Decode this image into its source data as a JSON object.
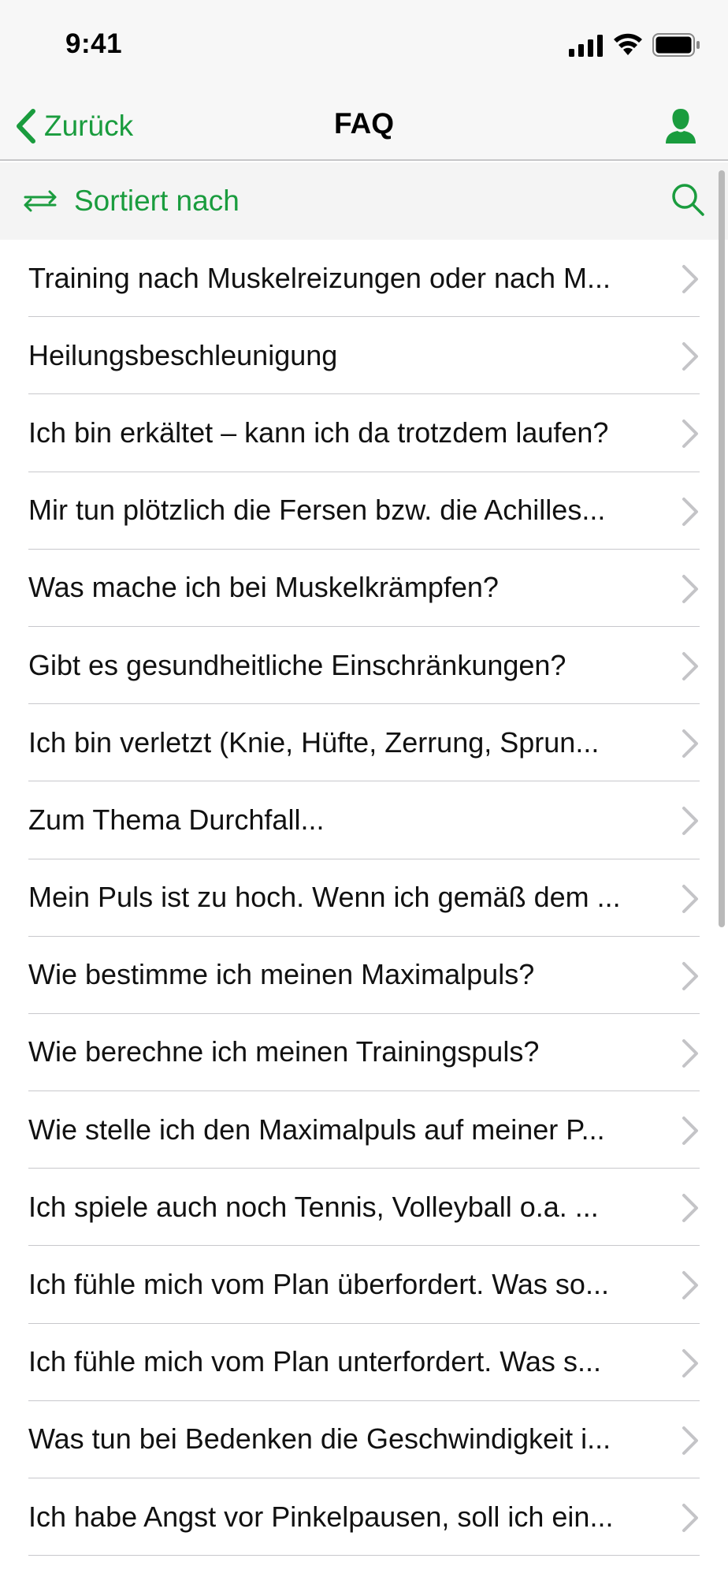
{
  "status_bar": {
    "time": "9:41"
  },
  "nav": {
    "back_label": "Zurück",
    "title": "FAQ"
  },
  "sort_bar": {
    "label": "Sortiert nach"
  },
  "accent_color": "#1a9c3e",
  "faq_items": [
    "Training nach Muskelreizungen oder nach M...",
    "Heilungsbeschleunigung",
    "Ich bin erkältet – kann ich da trotzdem laufen?",
    "Mir tun plötzlich die Fersen bzw. die Achilles...",
    "Was mache ich bei Muskelkrämpfen?",
    "Gibt es gesundheitliche Einschränkungen?",
    "Ich bin verletzt (Knie, Hüfte, Zerrung, Sprun...",
    "Zum Thema Durchfall...",
    "Mein Puls ist zu hoch. Wenn ich gemäß dem ...",
    "Wie bestimme ich meinen Maximalpuls?",
    "Wie berechne ich meinen Trainingspuls?",
    "Wie stelle ich den Maximalpuls auf meiner P...",
    "Ich spiele auch noch Tennis, Volleyball o.a. ...",
    "Ich fühle mich vom Plan überfordert. Was so...",
    "Ich fühle mich vom Plan unterfordert. Was s...",
    "Was tun bei Bedenken die Geschwindigkeit i...",
    "Ich habe Angst vor Pinkelpausen, soll ich ein..."
  ]
}
